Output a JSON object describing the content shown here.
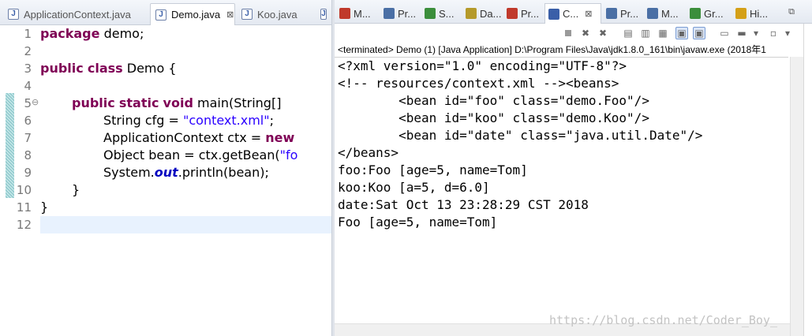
{
  "editor": {
    "tabs": [
      {
        "label": "ApplicationContext.java",
        "active": false
      },
      {
        "label": "Demo.java",
        "active": true,
        "close": "⊠"
      },
      {
        "label": "Koo.java",
        "active": false
      },
      {
        "label": "",
        "active": false
      }
    ],
    "line_numbers": [
      "1",
      "2",
      "3",
      "4",
      "5",
      "6",
      "7",
      "8",
      "9",
      "10",
      "11",
      "12"
    ],
    "code": {
      "l1_kw": "package",
      "l1_rest": " demo;",
      "l3_kw1": "public",
      "l3_kw2": "class",
      "l3_rest": " Demo {",
      "l5_kw1": "public",
      "l5_kw2": "static",
      "l5_kw3": "void",
      "l5_rest": " main(String[]",
      "l6_pre": "String cfg = ",
      "l6_str": "\"context.xml\"",
      "l6_post": ";",
      "l7_pre": "ApplicationContext ctx = ",
      "l7_kw": "new",
      "l8_pre": "Object bean = ctx.getBean(",
      "l8_str": "\"fo",
      "l9_pre": "System.",
      "l9_fld": "out",
      "l9_post": ".println(bean);",
      "l10": "}",
      "l11": "}"
    }
  },
  "console": {
    "view_tabs": [
      {
        "label": "M...",
        "icon_color": "#c0392b"
      },
      {
        "label": "Pr...",
        "icon_color": "#4a6fa5"
      },
      {
        "label": "S...",
        "icon_color": "#3b8e3b"
      },
      {
        "label": "Da...",
        "icon_color": "#b59a2a"
      },
      {
        "label": "Pr...",
        "icon_color": "#c0392b"
      },
      {
        "label": "C...",
        "icon_color": "#3a5fa8",
        "active": true,
        "close": "⊠"
      },
      {
        "label": "Pr...",
        "icon_color": "#4a6fa5"
      },
      {
        "label": "M...",
        "icon_color": "#4a6fa5"
      },
      {
        "label": "Gr...",
        "icon_color": "#3b8e3b"
      },
      {
        "label": "Hi...",
        "icon_color": "#d4a017"
      }
    ],
    "terminated_text": "<terminated> Demo (1) [Java Application] D:\\Program Files\\Java\\jdk1.8.0_161\\bin\\javaw.exe (2018年1",
    "output": [
      "<?xml version=\"1.0\" encoding=\"UTF-8\"?>",
      "<!-- resources/context.xml --><beans>",
      "        <bean id=\"foo\" class=\"demo.Foo\"/>",
      "        <bean id=\"koo\" class=\"demo.Koo\"/>",
      "        <bean id=\"date\" class=\"java.util.Date\"/>",
      "</beans>",
      "foo:Foo [age=5, name=Tom]",
      "koo:Koo [a=5, d=6.0]",
      "date:Sat Oct 13 23:28:29 CST 2018",
      "Foo [age=5, name=Tom]"
    ],
    "watermark": "https://blog.csdn.net/Coder_Boy_"
  }
}
